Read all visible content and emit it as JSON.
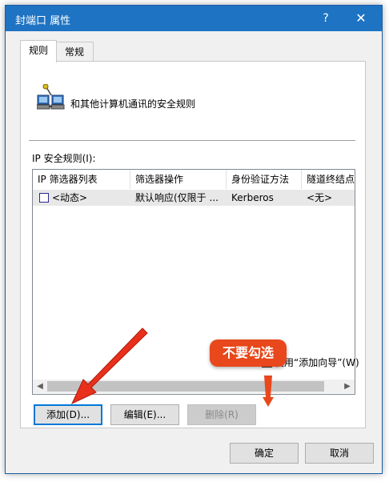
{
  "window": {
    "title": "封端口 属性",
    "help_label": "?",
    "close_label": "✕"
  },
  "tabs": [
    {
      "label": "规则",
      "active": true
    },
    {
      "label": "常规",
      "active": false
    }
  ],
  "header": {
    "icon": "network-computers-icon",
    "description": "和其他计算机通讯的安全规则"
  },
  "rules_list": {
    "label": "IP 安全规则(I):",
    "columns": [
      "IP 筛选器列表",
      "筛选器操作",
      "身份验证方法",
      "隧道终结点"
    ],
    "rows": [
      {
        "checked": false,
        "filter_list": "<动态>",
        "filter_action": "默认响应(仅限于 ...",
        "auth_method": "Kerberos",
        "tunnel_endpoint": "<无>"
      }
    ]
  },
  "buttons": {
    "add": "添加(D)...",
    "edit": "编辑(E)...",
    "delete": "删除(R)",
    "ok": "确定",
    "cancel": "取消"
  },
  "wizard_checkbox": {
    "label": "使用“添加向导”(W)",
    "checked": false
  },
  "annotation": {
    "callout_text": "不要勾选",
    "arrow_color": "#e8301c",
    "callout_color": "#e8481b"
  },
  "colors": {
    "titlebar": "#1e73c3",
    "focus_border": "#0078d7"
  }
}
